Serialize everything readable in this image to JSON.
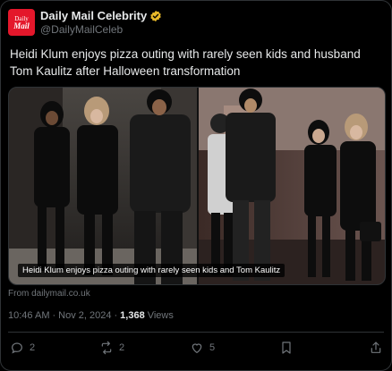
{
  "account": {
    "avatar_line1": "Daily",
    "avatar_line2": "Mail",
    "display_name": "Daily Mail Celebrity",
    "handle": "@DailyMailCeleb"
  },
  "tweet": {
    "text": "Heidi Klum enjoys pizza outing with rarely seen kids and husband Tom Kaulitz after Halloween transformation",
    "media_caption": "Heidi Klum enjoys pizza outing with rarely seen kids and Tom Kaulitz",
    "source": "From dailymail.co.uk",
    "time": "10:46 AM",
    "date": "Nov 2, 2024",
    "views_count": "1,368",
    "views_label": "Views"
  },
  "actions": {
    "replies": "2",
    "reposts": "2",
    "likes": "5"
  },
  "colors": {
    "background": "#000000",
    "verified": "#e8b829",
    "brand_red": "#e4172b",
    "muted_text": "#71767b",
    "divider": "#2f3336"
  },
  "icons": [
    "verified-badge-icon",
    "reply-icon",
    "repost-icon",
    "like-icon",
    "bookmark-icon",
    "share-icon"
  ]
}
